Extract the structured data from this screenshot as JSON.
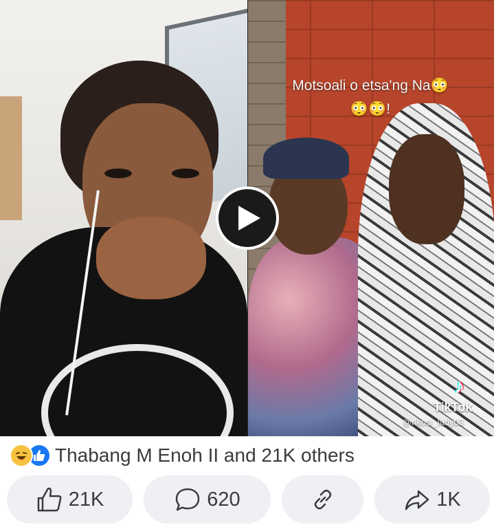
{
  "video": {
    "caption_line1": "Motsoali o etsa'ng Na😳",
    "caption_line2": "😳😳!",
    "watermark_brand": "TikTok",
    "watermark_user": "@nkosi_lady03"
  },
  "reactions": {
    "summary": "Thabang M Enoh II and 21K others",
    "icons": [
      "haha-icon",
      "like-icon"
    ]
  },
  "actions": {
    "like_count": "21K",
    "comment_count": "620",
    "share_count": "1K"
  },
  "colors": {
    "button_bg": "#eef0f3",
    "like_blue": "#1877f2",
    "haha_yellow": "#f7c241"
  }
}
